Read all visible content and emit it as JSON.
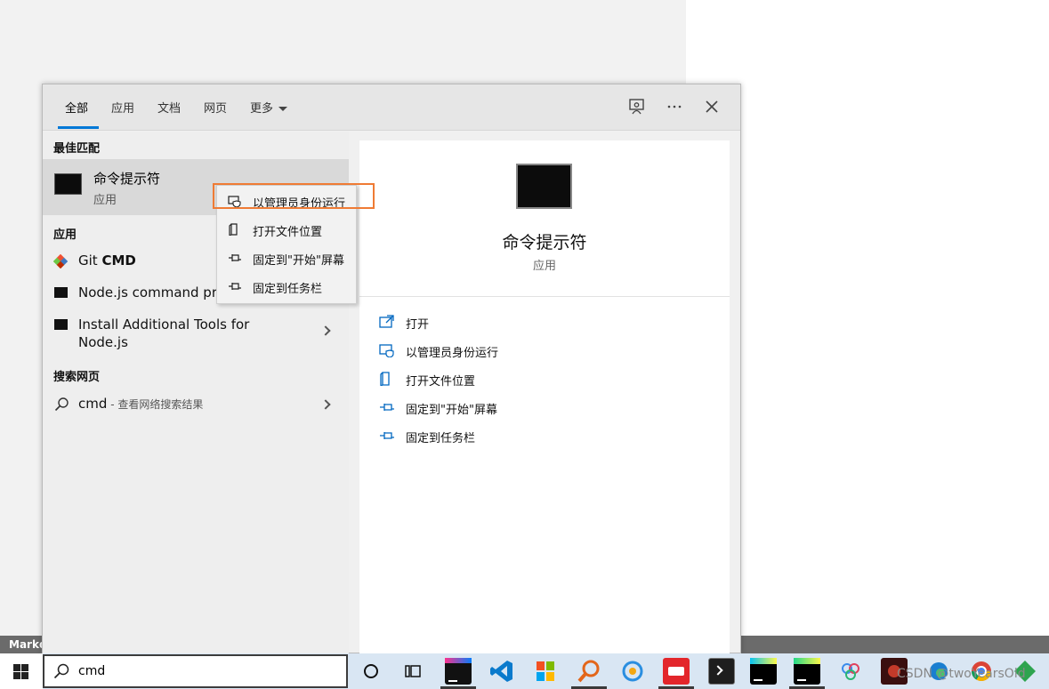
{
  "background": {
    "strip_text": "Markdo"
  },
  "tabs": [
    {
      "label": "全部"
    },
    {
      "label": "应用"
    },
    {
      "label": "文档"
    },
    {
      "label": "网页"
    },
    {
      "label": "更多"
    }
  ],
  "sections": {
    "best_match": "最佳匹配",
    "apps": "应用",
    "web": "搜索网页"
  },
  "best_match": {
    "title": "命令提示符",
    "subtitle": "应用"
  },
  "apps": [
    {
      "label_plain": "Git ",
      "label_bold": "CMD"
    },
    {
      "label": "Node.js command prompt"
    },
    {
      "label_line1": "Install Additional Tools for",
      "label_line2": "Node.js"
    }
  ],
  "web_result": {
    "query": "cmd",
    "suffix": " - 查看网络搜索结果"
  },
  "context_menu": [
    {
      "label": "以管理员身份运行"
    },
    {
      "label": "打开文件位置"
    },
    {
      "label": "固定到\"开始\"屏幕"
    },
    {
      "label": "固定到任务栏"
    }
  ],
  "preview": {
    "title": "命令提示符",
    "subtitle": "应用",
    "actions": [
      {
        "label": "打开"
      },
      {
        "label": "以管理员身份运行"
      },
      {
        "label": "打开文件位置"
      },
      {
        "label": "固定到\"开始\"屏幕"
      },
      {
        "label": "固定到任务栏"
      }
    ]
  },
  "taskbar": {
    "search_value": "cmd",
    "apps": [
      "intellij-idea",
      "vscode",
      "office",
      "search-tool",
      "browser",
      "youdao",
      "terminal",
      "webstorm",
      "pycharm",
      "cloud",
      "game",
      "edge",
      "chrome",
      "git-tool"
    ]
  },
  "watermark": "CSDN @twoYearsOld",
  "colors": {
    "accent": "#0078d7",
    "highlight_border": "#ef7b34",
    "taskbar": "#d9e6f3"
  }
}
